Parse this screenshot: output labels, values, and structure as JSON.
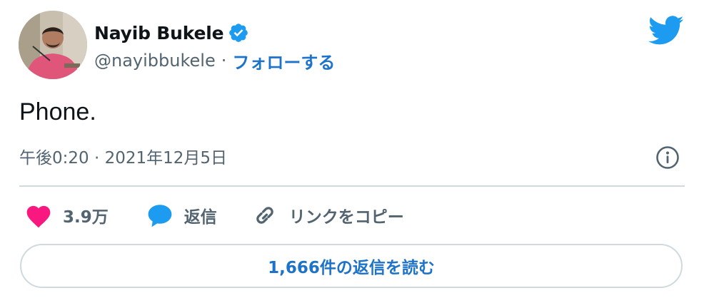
{
  "author": {
    "display_name": "Nayib Bukele",
    "handle": "@nayibbukele",
    "separator": "·",
    "follow_label": "フォローする"
  },
  "tweet": {
    "text": "Phone.",
    "timestamp": "午後0:20 · 2021年12月5日"
  },
  "actions": {
    "like_count": "3.9万",
    "reply_label": "返信",
    "copy_link_label": "リンクをコピー"
  },
  "read_replies_label": "1,666件の返信を読む",
  "colors": {
    "accent": "#1d9bf0",
    "link": "#1d72c9",
    "like": "#f91880",
    "secondary_text": "#536471",
    "border": "#cfd9de"
  },
  "icons": {
    "verified": "verified-badge-icon",
    "brand": "twitter-bird-icon",
    "info": "info-icon",
    "like": "heart-icon",
    "reply": "speech-bubble-icon",
    "copy": "link-icon"
  }
}
